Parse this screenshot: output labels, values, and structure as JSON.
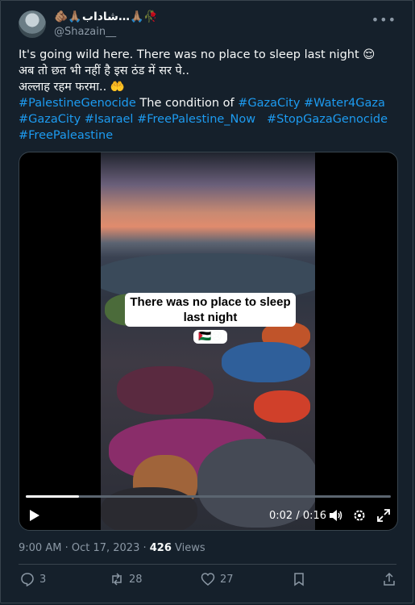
{
  "author": {
    "display_name": "🫵🏽🙏🏽شاداب…🙏🏽🥀",
    "handle": "@Shazain__"
  },
  "tweet": {
    "lines": [
      "It's going wild here. There was no place to sleep last night 😌",
      "अब तो छत भी नहीं है इस ठंड में सर पे..",
      "अल्लाह रहम फरमा.. 🤲"
    ],
    "tag_palestine_genocide": "#PalestineGenocide",
    "text_condition": " The condition of ",
    "tag_gaza_city": "#GazaCity",
    "tag_water4gaza": "#Water4Gaza",
    "tag_gaza_city_2": "#GazaCity",
    "tag_isarael": "#Isarael",
    "tag_free_palestine_now": "#FreePalestine_Now",
    "tag_stop_gaza_genocide": "#StopGazaGenocide",
    "tag_free_paleastine": "#FreePaleastine"
  },
  "video": {
    "caption_line1": "There was no place to sleep",
    "caption_line2": "last night",
    "caption_emoji": "🇵🇸😢",
    "time_display": "0:02 / 0:16",
    "progress_fraction": 0.146
  },
  "meta": {
    "time": "9:00 AM",
    "separator": " · ",
    "date": "Oct 17, 2023",
    "views_count": "426",
    "views_label": " Views"
  },
  "actions": {
    "replies": "3",
    "retweets": "28",
    "likes": "27"
  },
  "icons": [
    "more-icon",
    "play-icon",
    "volume-icon",
    "settings-icon",
    "fullscreen-icon",
    "reply-icon",
    "retweet-icon",
    "like-icon",
    "bookmark-icon",
    "share-icon"
  ],
  "colors": {
    "background": "#15202b",
    "link": "#1d9bf0",
    "muted": "#8b98a5",
    "border": "#38444d"
  }
}
